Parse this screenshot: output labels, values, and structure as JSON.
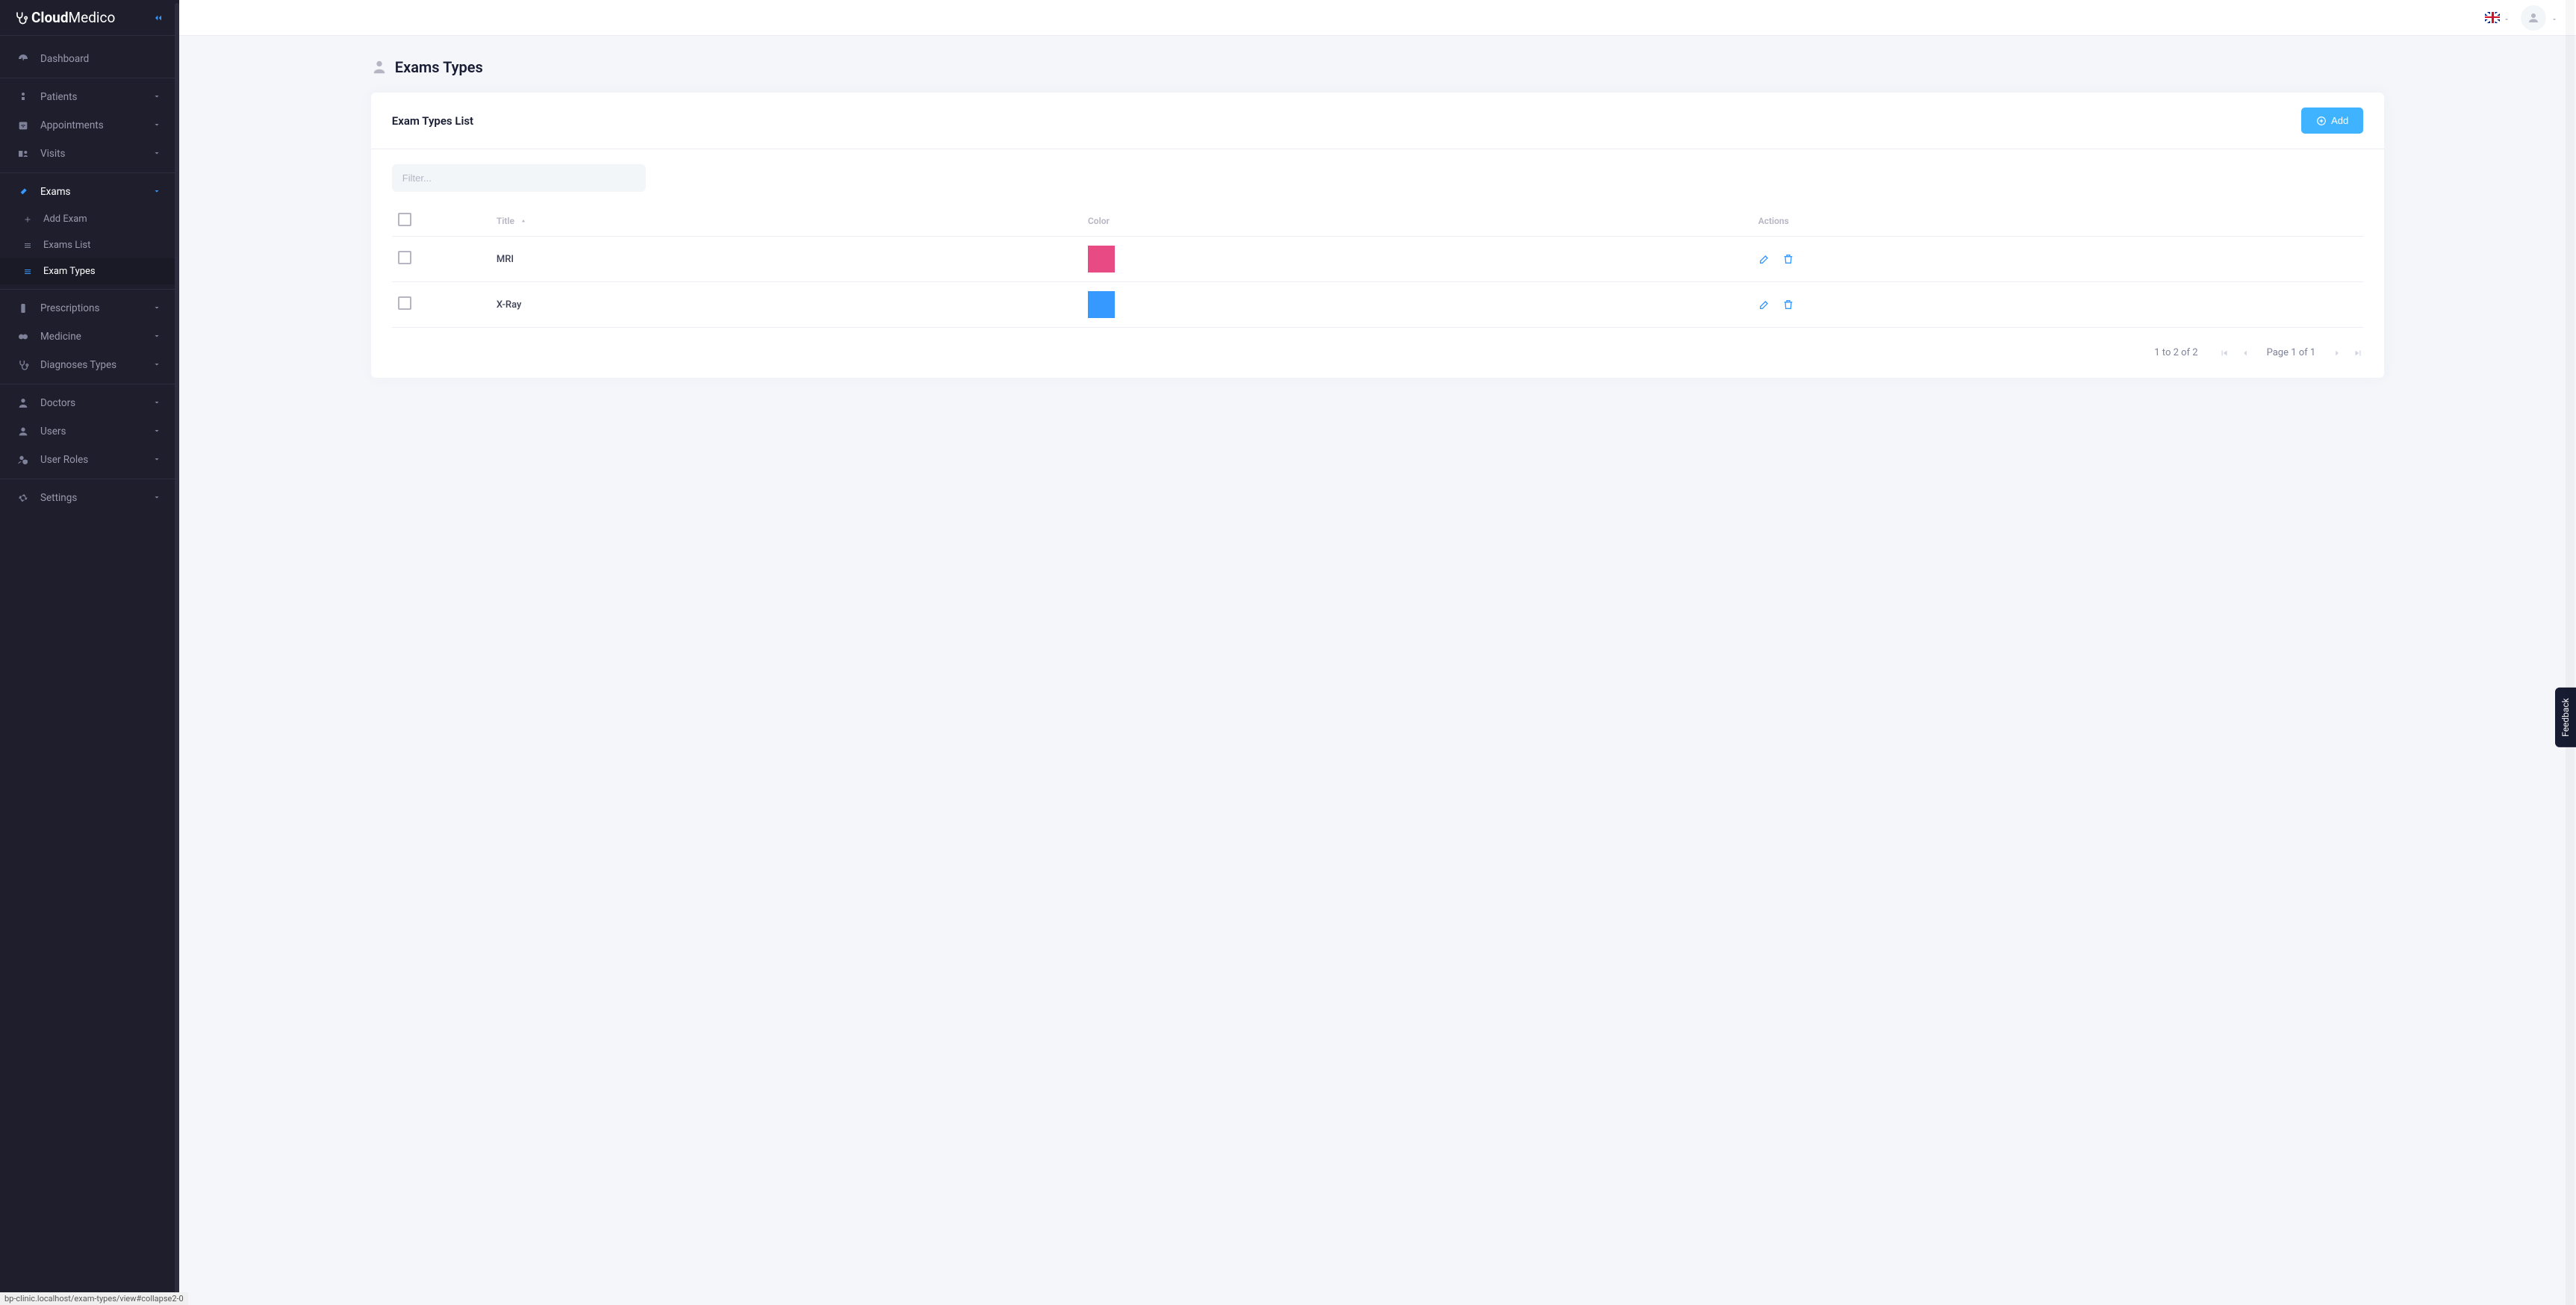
{
  "brand": {
    "name_bold": "Cloud",
    "name_light": "Medico"
  },
  "sidebar": {
    "dashboard": "Dashboard",
    "patients": "Patients",
    "appointments": "Appointments",
    "visits": "Visits",
    "exams": {
      "label": "Exams",
      "add_exam": "Add Exam",
      "exams_list": "Exams List",
      "exam_types": "Exam Types"
    },
    "prescriptions": "Prescriptions",
    "medicine": "Medicine",
    "diagnoses_types": "Diagnoses Types",
    "doctors": "Doctors",
    "users": "Users",
    "user_roles": "User Roles",
    "settings": "Settings"
  },
  "page": {
    "title": "Exams Types",
    "card_title": "Exam Types List",
    "add_button": "Add",
    "filter_placeholder": "Filter..."
  },
  "table": {
    "headers": {
      "title": "Title",
      "color": "Color",
      "actions": "Actions"
    },
    "rows": [
      {
        "title": "MRI",
        "color": "#e84a84"
      },
      {
        "title": "X-Ray",
        "color": "#3699ff"
      }
    ]
  },
  "pagination": {
    "range": "1 to 2 of 2",
    "page": "Page 1 of 1"
  },
  "feedback": "Feedback",
  "status_bar": "bp-clinic.localhost/exam-types/view#collapse2-0"
}
